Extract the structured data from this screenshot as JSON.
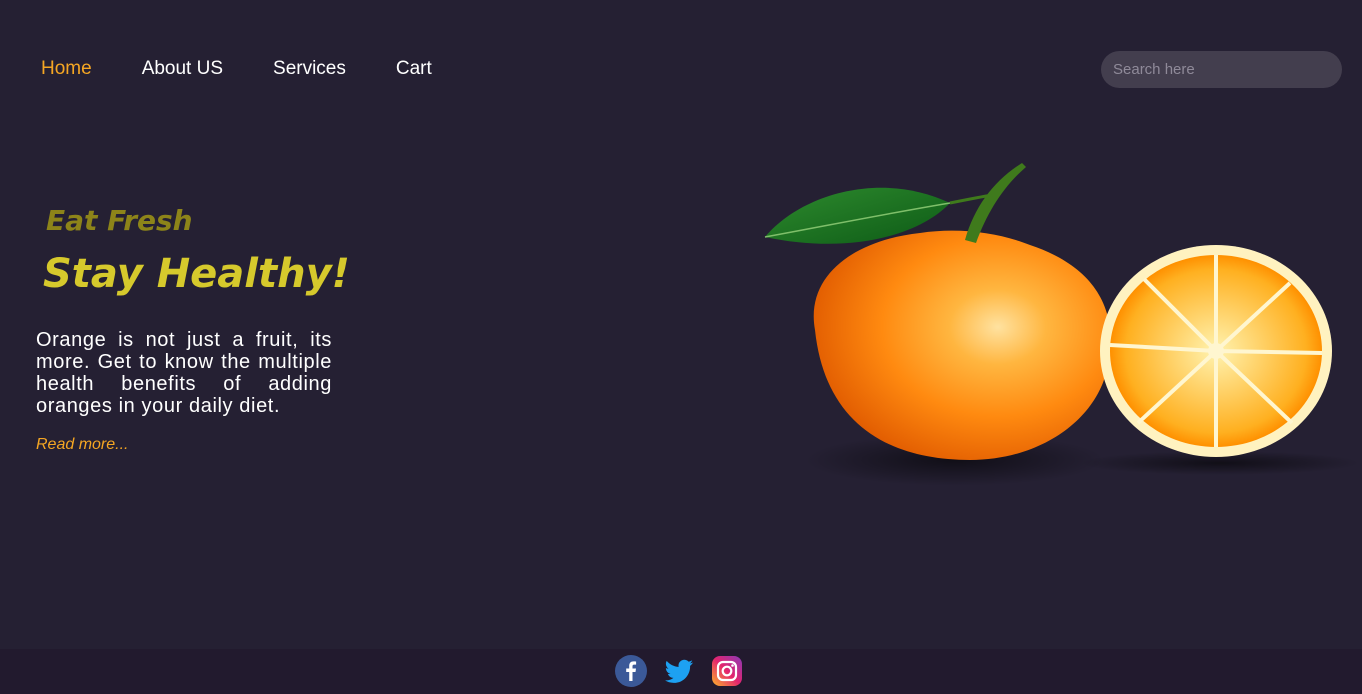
{
  "nav": {
    "items": [
      {
        "label": "Home",
        "active": true
      },
      {
        "label": "About US",
        "active": false
      },
      {
        "label": "Services",
        "active": false
      },
      {
        "label": "Cart",
        "active": false
      }
    ]
  },
  "search": {
    "placeholder": "Search here",
    "value": ""
  },
  "hero": {
    "eyebrow": "Eat Fresh",
    "headline": "Stay Healthy!",
    "description": "Orange is not just a fruit, its more. Get to know the multiple health benefits of adding oranges in your daily diet.",
    "read_more": "Read more..."
  },
  "footer": {
    "social": [
      "facebook-icon",
      "twitter-icon",
      "instagram-icon"
    ]
  },
  "colors": {
    "background": "#252033",
    "footer": "#221a2e",
    "accent": "#f5a623",
    "eyebrow": "#8d8419",
    "headline": "#d6c92c"
  }
}
